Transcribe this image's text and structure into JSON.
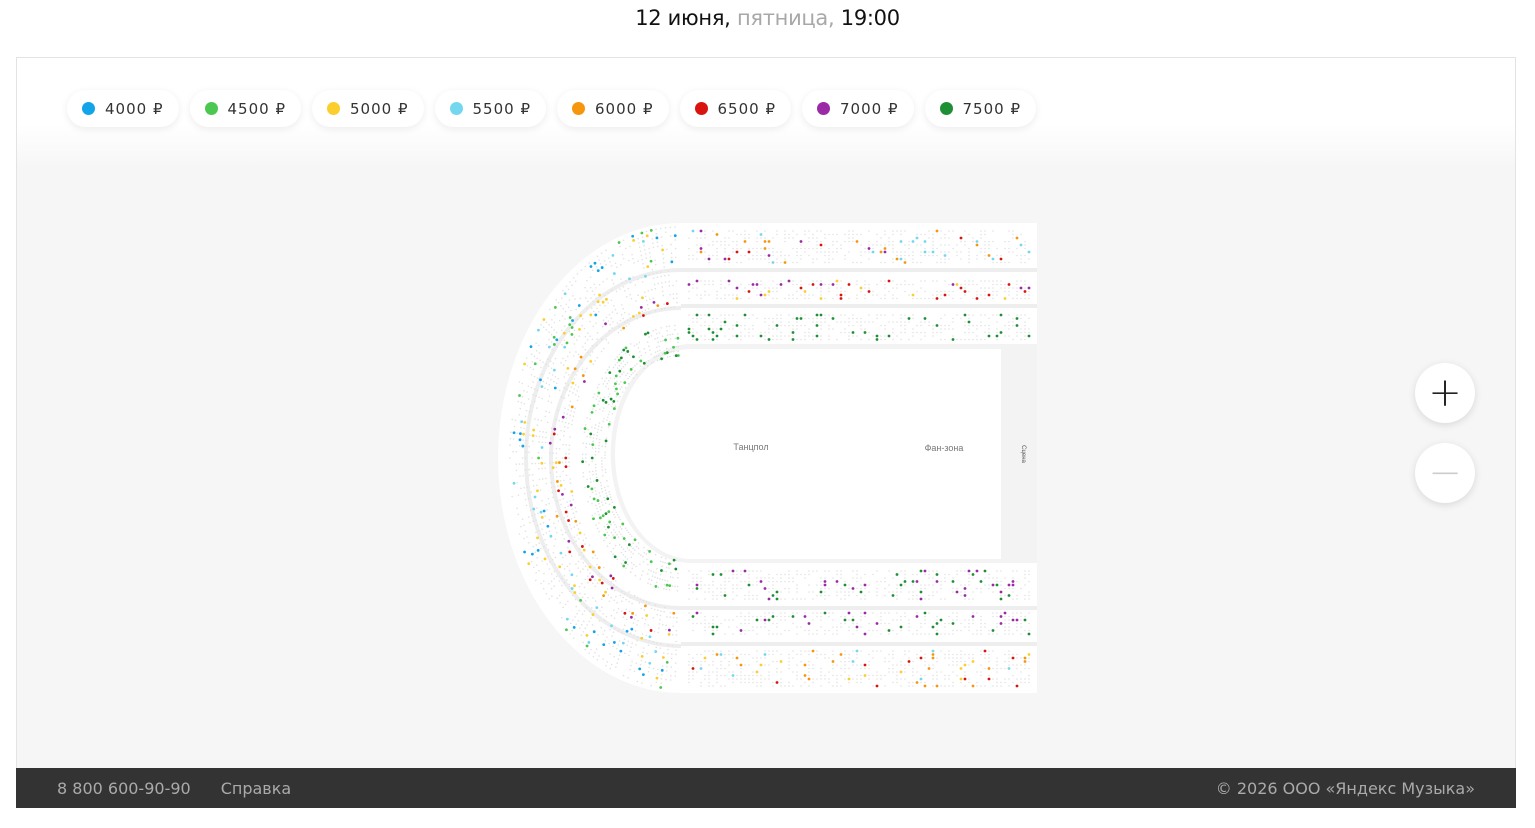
{
  "header": {
    "date": "12 июня,",
    "weekday": "пятница,",
    "time": "19:00"
  },
  "legend": [
    {
      "price": "4000 ₽",
      "color": "#12a4e8"
    },
    {
      "price": "4500 ₽",
      "color": "#4cc752"
    },
    {
      "price": "5000 ₽",
      "color": "#fbce2e"
    },
    {
      "price": "5500 ₽",
      "color": "#74d7f0"
    },
    {
      "price": "6000 ₽",
      "color": "#f5960c"
    },
    {
      "price": "6500 ₽",
      "color": "#d9140f"
    },
    {
      "price": "7000 ₽",
      "color": "#9b2aa6"
    },
    {
      "price": "7500 ₽",
      "color": "#1f8f35"
    }
  ],
  "map": {
    "dance_floor": "Танцпол",
    "fan_zone": "Фан-зона",
    "stage": "Сцена"
  },
  "zoom": {
    "in": "+",
    "out": "−"
  },
  "footer": {
    "phone": "8 800 600-90-90",
    "help": "Справка",
    "copyright": "© 2026 ООО «Яндекс Музыка»"
  }
}
